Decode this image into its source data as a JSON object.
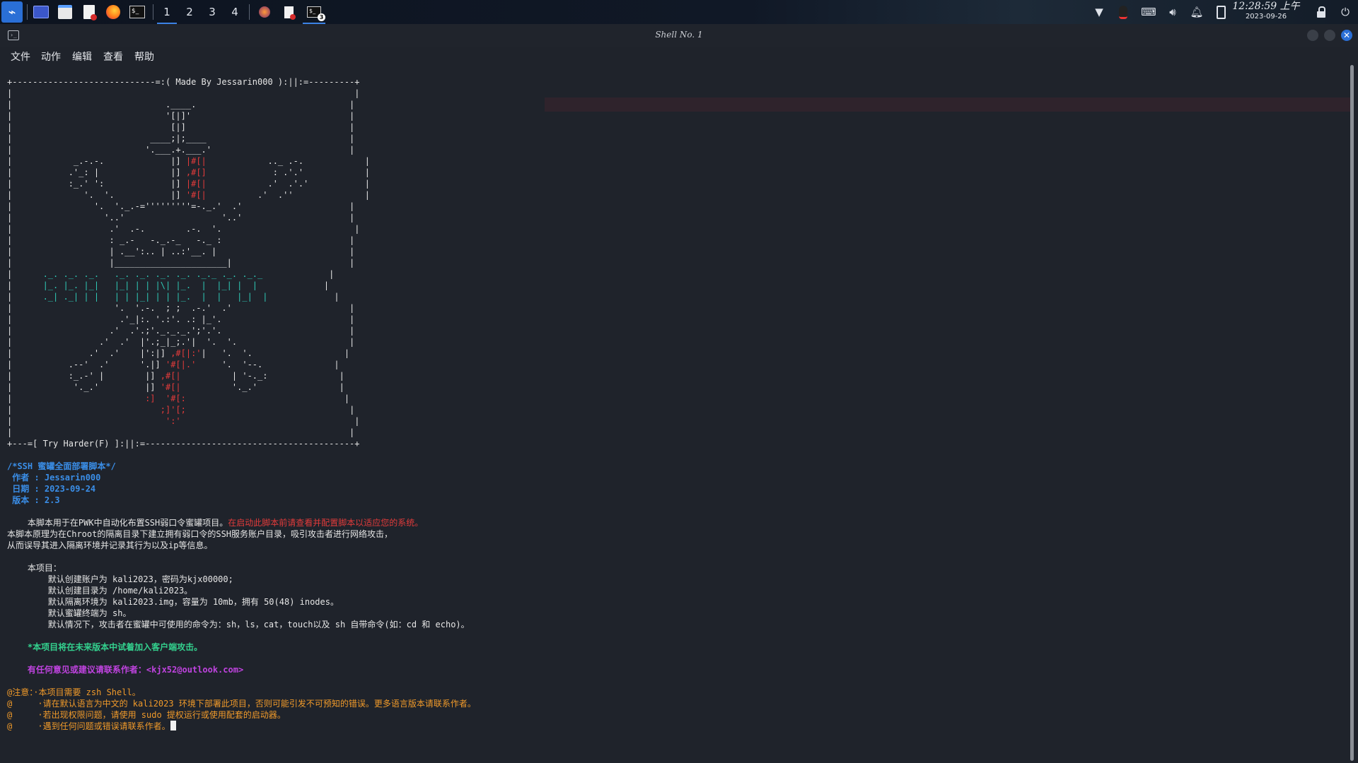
{
  "panel": {
    "workspaces": [
      "1",
      "2",
      "3",
      "4"
    ],
    "active_workspace": "1",
    "terminal_badge": "3",
    "clock_time": "12:28:59 上午",
    "clock_date": "2023-09-26",
    "icons": [
      "kali-menu-icon",
      "desktop-icon",
      "files-icon",
      "text-editor-icon",
      "firefox-icon",
      "terminal-icon",
      "firefox-task-icon",
      "editor-task-icon",
      "terminal-task-icon",
      "network-icon",
      "qq-icon",
      "keyboard-icon",
      "volume-icon",
      "notifications-icon",
      "battery-icon",
      "lock-icon",
      "power-icon"
    ],
    "colors": {
      "accent": "#3c82e6"
    }
  },
  "window": {
    "title": "Shell No. 1",
    "menu": [
      "文件",
      "动作",
      "编辑",
      "查看",
      "帮助"
    ],
    "colors": {
      "close": "#2b6fd6",
      "btn": "#3a3f48"
    }
  },
  "terminal": {
    "lines": [
      {
        "segs": [
          {
            "t": "+----------------------------=:( Made By Jessarin000 ):||:=---------+",
            "c": ""
          }
        ]
      },
      {
        "segs": [
          {
            "t": "|                                                                   |",
            "c": ""
          }
        ]
      },
      {
        "segs": [
          {
            "t": "|                              .____.                              |",
            "c": ""
          }
        ]
      },
      {
        "segs": [
          {
            "t": "|                              '[|]'                               |",
            "c": ""
          }
        ]
      },
      {
        "segs": [
          {
            "t": "|                               [|]                                |",
            "c": ""
          }
        ]
      },
      {
        "segs": [
          {
            "t": "|                           ____;|;____                            |",
            "c": ""
          }
        ]
      },
      {
        "segs": [
          {
            "t": "|                          '.___.+.___.'                           |",
            "c": ""
          }
        ]
      },
      {
        "segs": [
          {
            "t": "|            _.-.-.             |] ",
            "c": ""
          },
          {
            "t": "|#[|",
            "c": "red"
          },
          {
            "t": "            .._ .-.            |",
            "c": ""
          }
        ]
      },
      {
        "segs": [
          {
            "t": "|           .'_: |              |] ",
            "c": ""
          },
          {
            "t": ",#[]",
            "c": "red"
          },
          {
            "t": "             : .'.'            |",
            "c": ""
          }
        ]
      },
      {
        "segs": [
          {
            "t": "|           :_.' ':             |] ",
            "c": ""
          },
          {
            "t": "|#[|",
            "c": "red"
          },
          {
            "t": "            .'  .'.'           |",
            "c": ""
          }
        ]
      },
      {
        "segs": [
          {
            "t": "|              '.  '.           |] ",
            "c": ""
          },
          {
            "t": "'#[|",
            "c": "red"
          },
          {
            "t": "          .'  .''              |",
            "c": ""
          }
        ]
      },
      {
        "segs": [
          {
            "t": "|                '.  '._.-='''''''''=-._.'  .'                     |",
            "c": ""
          }
        ]
      },
      {
        "segs": [
          {
            "t": "|                  '..'                   '..'                     |",
            "c": ""
          }
        ]
      },
      {
        "segs": [
          {
            "t": "|                   .'  .-.        .-.  '.                          |",
            "c": ""
          }
        ]
      },
      {
        "segs": [
          {
            "t": "|                   : _.-   -._.-_   -._ :                         |",
            "c": ""
          }
        ]
      },
      {
        "segs": [
          {
            "t": "|                   | .__':.. | ..:'__. |                          |",
            "c": ""
          }
        ]
      },
      {
        "segs": [
          {
            "t": "|                   |______________________|                       |",
            "c": ""
          }
        ]
      },
      {
        "segs": [
          {
            "t": "|      ",
            "c": ""
          },
          {
            "t": "._. ._. ._.   ._. ._. ._. ._. ._._ ._. ._._",
            "c": "cyan"
          },
          {
            "t": "             |",
            "c": ""
          }
        ]
      },
      {
        "segs": [
          {
            "t": "|      ",
            "c": ""
          },
          {
            "t": "|_. |_. |_|   |_| | | |\\| |_.  |  |_| |  |",
            "c": "cyan"
          },
          {
            "t": "             |",
            "c": ""
          }
        ]
      },
      {
        "segs": [
          {
            "t": "|      ",
            "c": ""
          },
          {
            "t": "._| ._| | |   | | |_| | | |_.  |  |   |_|  |",
            "c": "cyan"
          },
          {
            "t": "             |",
            "c": ""
          }
        ]
      },
      {
        "segs": [
          {
            "t": "|                    '.  '.-.  ; ;  .-.'  .'                       |",
            "c": ""
          }
        ]
      },
      {
        "segs": [
          {
            "t": "|                     .'_|:. '.:'. .: |_'.                         |",
            "c": ""
          }
        ]
      },
      {
        "segs": [
          {
            "t": "|                   .'  .'.;'._._._.';'.'.                         |",
            "c": ""
          }
        ]
      },
      {
        "segs": [
          {
            "t": "|                 .'  .'  |'.;_|_;.'|  '.  '.                      |",
            "c": ""
          }
        ]
      },
      {
        "segs": [
          {
            "t": "|               .'  .'    |':|] ",
            "c": ""
          },
          {
            "t": ",#[|:'",
            "c": "red"
          },
          {
            "t": "|   '.  '.                  |",
            "c": ""
          }
        ]
      },
      {
        "segs": [
          {
            "t": "|           .--'  .'      '.|] ",
            "c": ""
          },
          {
            "t": "'#[|.'",
            "c": "red"
          },
          {
            "t": "     '.  '--.              |",
            "c": ""
          }
        ]
      },
      {
        "segs": [
          {
            "t": "|           :_.-' |        |] ",
            "c": ""
          },
          {
            "t": ",#[|",
            "c": "red"
          },
          {
            "t": "          | '-._:              |",
            "c": ""
          }
        ]
      },
      {
        "segs": [
          {
            "t": "|            '._.'         |] ",
            "c": ""
          },
          {
            "t": "'#[|",
            "c": "red"
          },
          {
            "t": "          '._.'                |",
            "c": ""
          }
        ]
      },
      {
        "segs": [
          {
            "t": "|                          ",
            "c": ""
          },
          {
            "t": ":]  '#[:",
            "c": "red"
          },
          {
            "t": "                               |",
            "c": ""
          }
        ]
      },
      {
        "segs": [
          {
            "t": "|                             ",
            "c": ""
          },
          {
            "t": ";]'[;",
            "c": "red"
          },
          {
            "t": "                                |",
            "c": ""
          }
        ]
      },
      {
        "segs": [
          {
            "t": "|                              ",
            "c": ""
          },
          {
            "t": "':'",
            "c": "red"
          },
          {
            "t": "                                  |",
            "c": ""
          }
        ]
      },
      {
        "segs": [
          {
            "t": "|                                                                  |",
            "c": ""
          }
        ]
      },
      {
        "segs": [
          {
            "t": "+---=[ Try Harder(F) ]:||:=-----------------------------------------+",
            "c": ""
          }
        ]
      },
      {
        "segs": [
          {
            "t": "",
            "c": ""
          }
        ]
      },
      {
        "segs": [
          {
            "t": "/*SSH 蜜罐全面部署脚本*/",
            "c": "blue"
          }
        ]
      },
      {
        "segs": [
          {
            "t": " 作者 : Jessarin000",
            "c": "blue"
          }
        ]
      },
      {
        "segs": [
          {
            "t": " 日期 : 2023-09-24",
            "c": "blue"
          }
        ]
      },
      {
        "segs": [
          {
            "t": " 版本 : 2.3",
            "c": "blue"
          }
        ]
      },
      {
        "segs": [
          {
            "t": "",
            "c": ""
          }
        ]
      },
      {
        "segs": [
          {
            "t": "    本脚本用于在PWK中自动化布置SSH弱口令蜜罐项目。",
            "c": ""
          },
          {
            "t": "在启动此脚本前请查看并配置脚本以适应您的系统。",
            "c": "red"
          }
        ]
      },
      {
        "segs": [
          {
            "t": "本脚本原理为在Chroot的隔离目录下建立拥有弱口令的SSH服务账户目录，吸引攻击者进行网络攻击，",
            "c": ""
          }
        ]
      },
      {
        "segs": [
          {
            "t": "从而误导其进入隔离环境并记录其行为以及ip等信息。",
            "c": ""
          }
        ]
      },
      {
        "segs": [
          {
            "t": "",
            "c": ""
          }
        ]
      },
      {
        "segs": [
          {
            "t": "    本项目：",
            "c": ""
          }
        ]
      },
      {
        "segs": [
          {
            "t": "        默认创建账户为 kali2023，密码为kjx00000;",
            "c": ""
          }
        ]
      },
      {
        "segs": [
          {
            "t": "        默认创建目录为 /home/kali2023。",
            "c": ""
          }
        ]
      },
      {
        "segs": [
          {
            "t": "        默认隔离环境为 kali2023.img，容量为 10mb，拥有 50(48) inodes。",
            "c": ""
          }
        ]
      },
      {
        "segs": [
          {
            "t": "        默认蜜罐终端为 sh。",
            "c": ""
          }
        ]
      },
      {
        "segs": [
          {
            "t": "        默认情况下，攻击者在蜜罐中可使用的命令为：sh，ls，cat，touch以及 sh 自带命令(如：cd 和 echo)。",
            "c": ""
          }
        ]
      },
      {
        "segs": [
          {
            "t": "",
            "c": ""
          }
        ]
      },
      {
        "segs": [
          {
            "t": "    *本项目将在未来版本中试着加入客户端攻击。",
            "c": "grn"
          }
        ]
      },
      {
        "segs": [
          {
            "t": "",
            "c": ""
          }
        ]
      },
      {
        "segs": [
          {
            "t": "    有任何意见或建议请联系作者：<kjx52@outlook.com>",
            "c": "mag"
          }
        ]
      },
      {
        "segs": [
          {
            "t": "",
            "c": ""
          }
        ]
      },
      {
        "segs": [
          {
            "t": "@注意：·本项目需要 zsh Shell。",
            "c": "org"
          }
        ]
      },
      {
        "segs": [
          {
            "t": "@     ·请在默认语言为中文的 kali2023 环境下部署此项目，否则可能引发不可预知的错误。更多语言版本请联系作者。",
            "c": "org"
          }
        ]
      },
      {
        "segs": [
          {
            "t": "@     ·若出现权限问题，请使用 sudo 提权运行或使用配套的启动器。",
            "c": "org"
          }
        ]
      },
      {
        "segs": [
          {
            "t": "@     ·遇到任何问题或错误请联系作者。",
            "c": "org"
          }
        ],
        "cursor": true
      }
    ]
  }
}
